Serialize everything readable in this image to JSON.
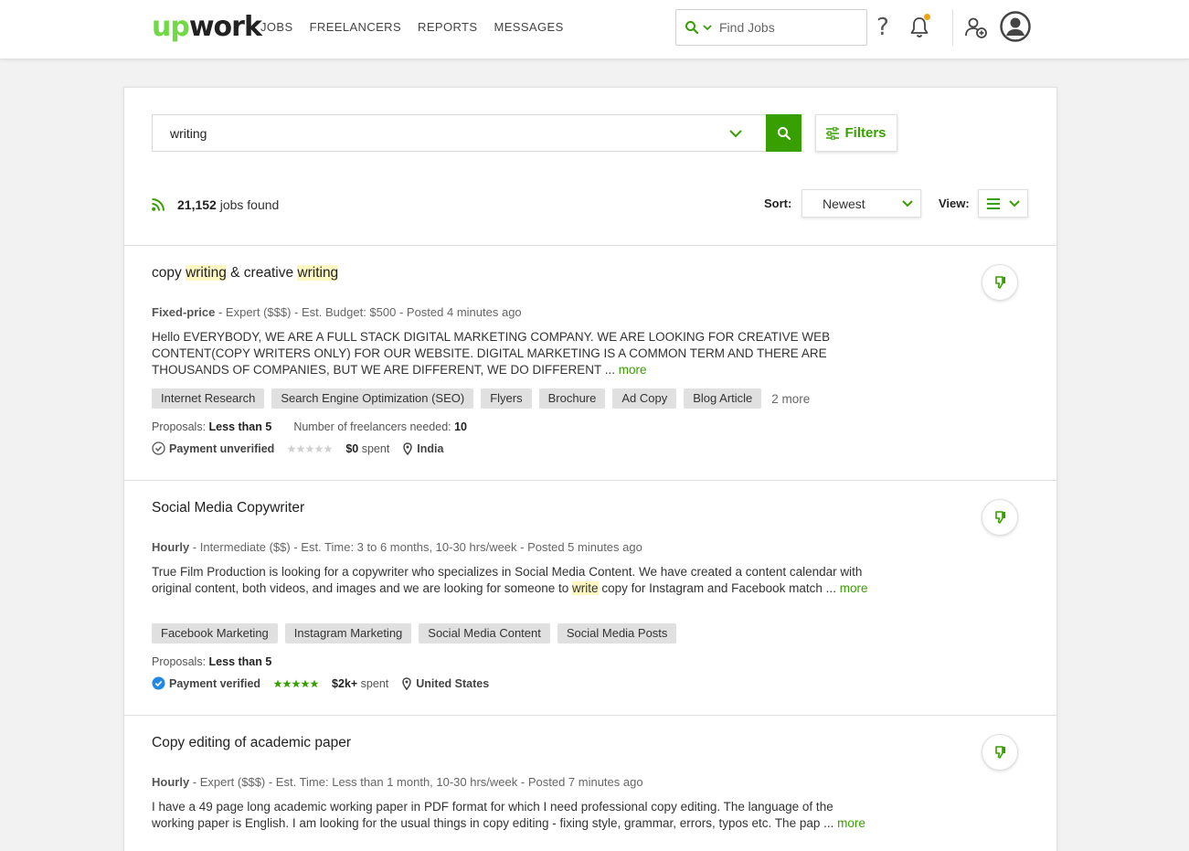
{
  "nav": {
    "logo_up": "up",
    "logo_work": "work",
    "links": [
      "JOBS",
      "FREELANCERS",
      "REPORTS",
      "MESSAGES"
    ],
    "search_placeholder": "Find Jobs",
    "help_glyph": "?",
    "notification_dot_color": "#f0a30a"
  },
  "search": {
    "query": "writing",
    "filters_label": "Filters"
  },
  "results": {
    "count": "21,152",
    "suffix": " jobs found",
    "sort_label": "Sort:",
    "sort_value": "Newest",
    "view_label": "View:"
  },
  "jobs": [
    {
      "title_parts": [
        "copy ",
        "writing",
        " & creative ",
        "writing"
      ],
      "type": "Fixed-price",
      "meta": " - Expert ($$$) - Est. Budget: $500 - Posted 4 minutes ago",
      "description": "Hello EVERYBODY, WE ARE A FULL STACK DIGITAL MARKETING COMPANY. WE ARE LOOKING FOR CREATIVE WEB CONTENT(COPY WRITERS ONLY) FOR OUR WEBSITE. DIGITAL MARKETING IS A COMMON TERM AND THERE ARE THOUSANDS OF COMPANIES, BUT WE ARE DIFFERENT, WE DO DIFFERENT ... ",
      "more": "more",
      "skills": [
        "Internet Research",
        "Search Engine Optimization (SEO)",
        "Flyers",
        "Brochure",
        "Ad Copy",
        "Blog Article"
      ],
      "skills_more": "2 more",
      "proposals_label": "Proposals: ",
      "proposals": "Less than 5",
      "freelancers_label": "Number of freelancers needed: ",
      "freelancers": "10",
      "payment": "Payment unverified",
      "rating": 0,
      "spent_amount": "$0",
      "spent_suffix": " spent",
      "location": "India"
    },
    {
      "title_parts": [
        "Social Media Copywriter"
      ],
      "type": "Hourly",
      "meta": " - Intermediate ($$) - Est. Time: 3 to 6 months, 10-30 hrs/week - Posted 5 minutes ago",
      "description_parts": [
        "True Film Production is looking for a copywriter who specializes in Social Media Content. We have created a content calendar with original content, both videos, and images and we are looking for someone to ",
        "write",
        " copy for Instagram and Facebook match ... "
      ],
      "more": "more",
      "skills": [
        "Facebook Marketing",
        "Instagram Marketing",
        "Social Media Content",
        "Social Media Posts"
      ],
      "proposals_label": "Proposals: ",
      "proposals": "Less than 5",
      "payment": "Payment verified",
      "rating": 5,
      "spent_amount": "$2k+",
      "spent_suffix": " spent",
      "location": "United States"
    },
    {
      "title_parts": [
        "Copy editing of academic paper"
      ],
      "type": "Hourly",
      "meta": " - Expert ($$$) - Est. Time: Less than 1 month, 10-30 hrs/week - Posted 7 minutes ago",
      "description": "I have a 49 page long academic working paper in PDF format for which I need professional copy editing. The language of the working paper is English. I am looking for the usual things in copy editing - fixing style, grammar, errors, typos etc. The pap ... ",
      "more": "more"
    }
  ],
  "colors": {
    "brand_green": "#37a000",
    "logo_green": "#6fda44",
    "highlight": "#fdf7c2",
    "verified_blue": "#1f87e5"
  }
}
